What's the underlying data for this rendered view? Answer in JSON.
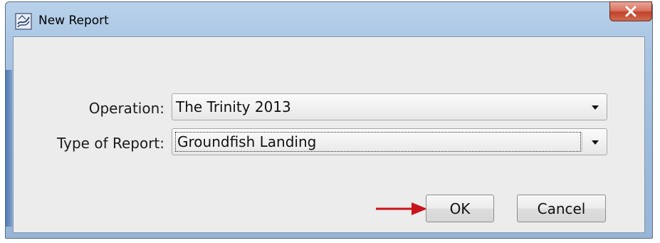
{
  "window": {
    "title": "New Report",
    "icon": "report-app-icon",
    "close_icon": "close-icon"
  },
  "form": {
    "operation_label": "Operation:",
    "operation_value": "The Trinity 2013",
    "type_label": "Type of Report:",
    "type_value": "Groundfish Landing"
  },
  "buttons": {
    "ok_label": "OK",
    "cancel_label": "Cancel"
  },
  "annotation": {
    "arrow_color": "#c8141a",
    "points_to": "ok-button"
  },
  "colors": {
    "close_button": "#c8432a",
    "title_bar": "#a9c5e3",
    "dialog_background": "#ececec"
  }
}
